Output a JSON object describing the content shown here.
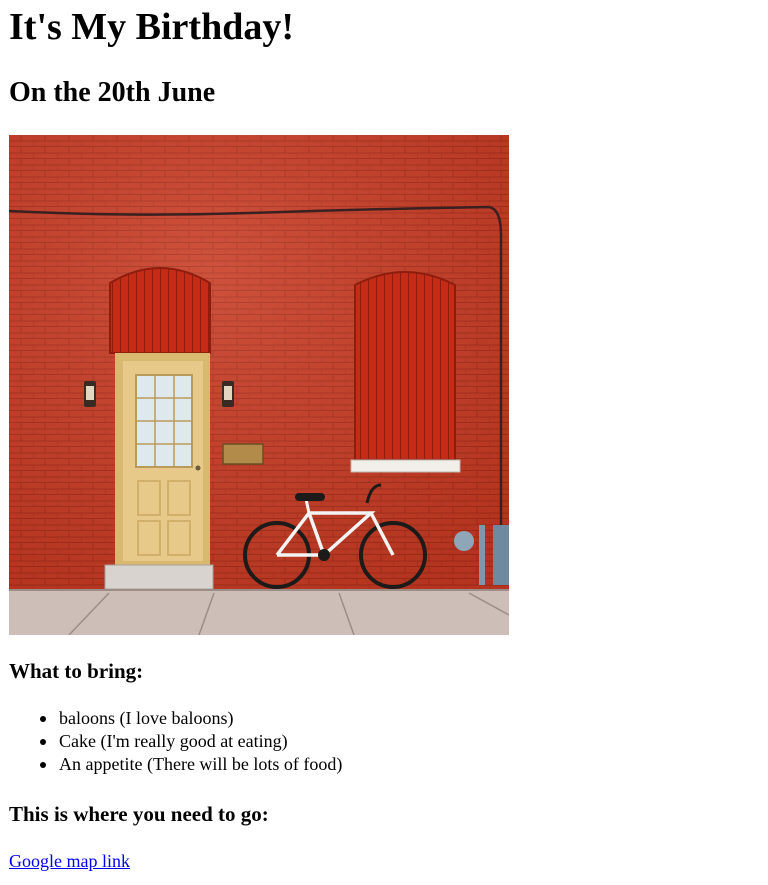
{
  "heading": "It's My Birthday!",
  "subheading": "On the 20th June",
  "photo": {
    "icon": "red-brick-wall-with-door-and-bicycle-photo",
    "colors": {
      "wall": "#c83a22",
      "door": "#e7c98a",
      "shutter": "#c02a16",
      "sidewalk": "#cdbfb7"
    }
  },
  "bring": {
    "title": "What to bring:",
    "items": [
      "baloons (I love baloons)",
      "Cake (I'm really good at eating)",
      "An appetite (There will be lots of food)"
    ]
  },
  "location": {
    "title": "This is where you need to go:",
    "link_text": "Google map link"
  },
  "colors": {
    "link": "#0000ee",
    "text": "#000000"
  }
}
